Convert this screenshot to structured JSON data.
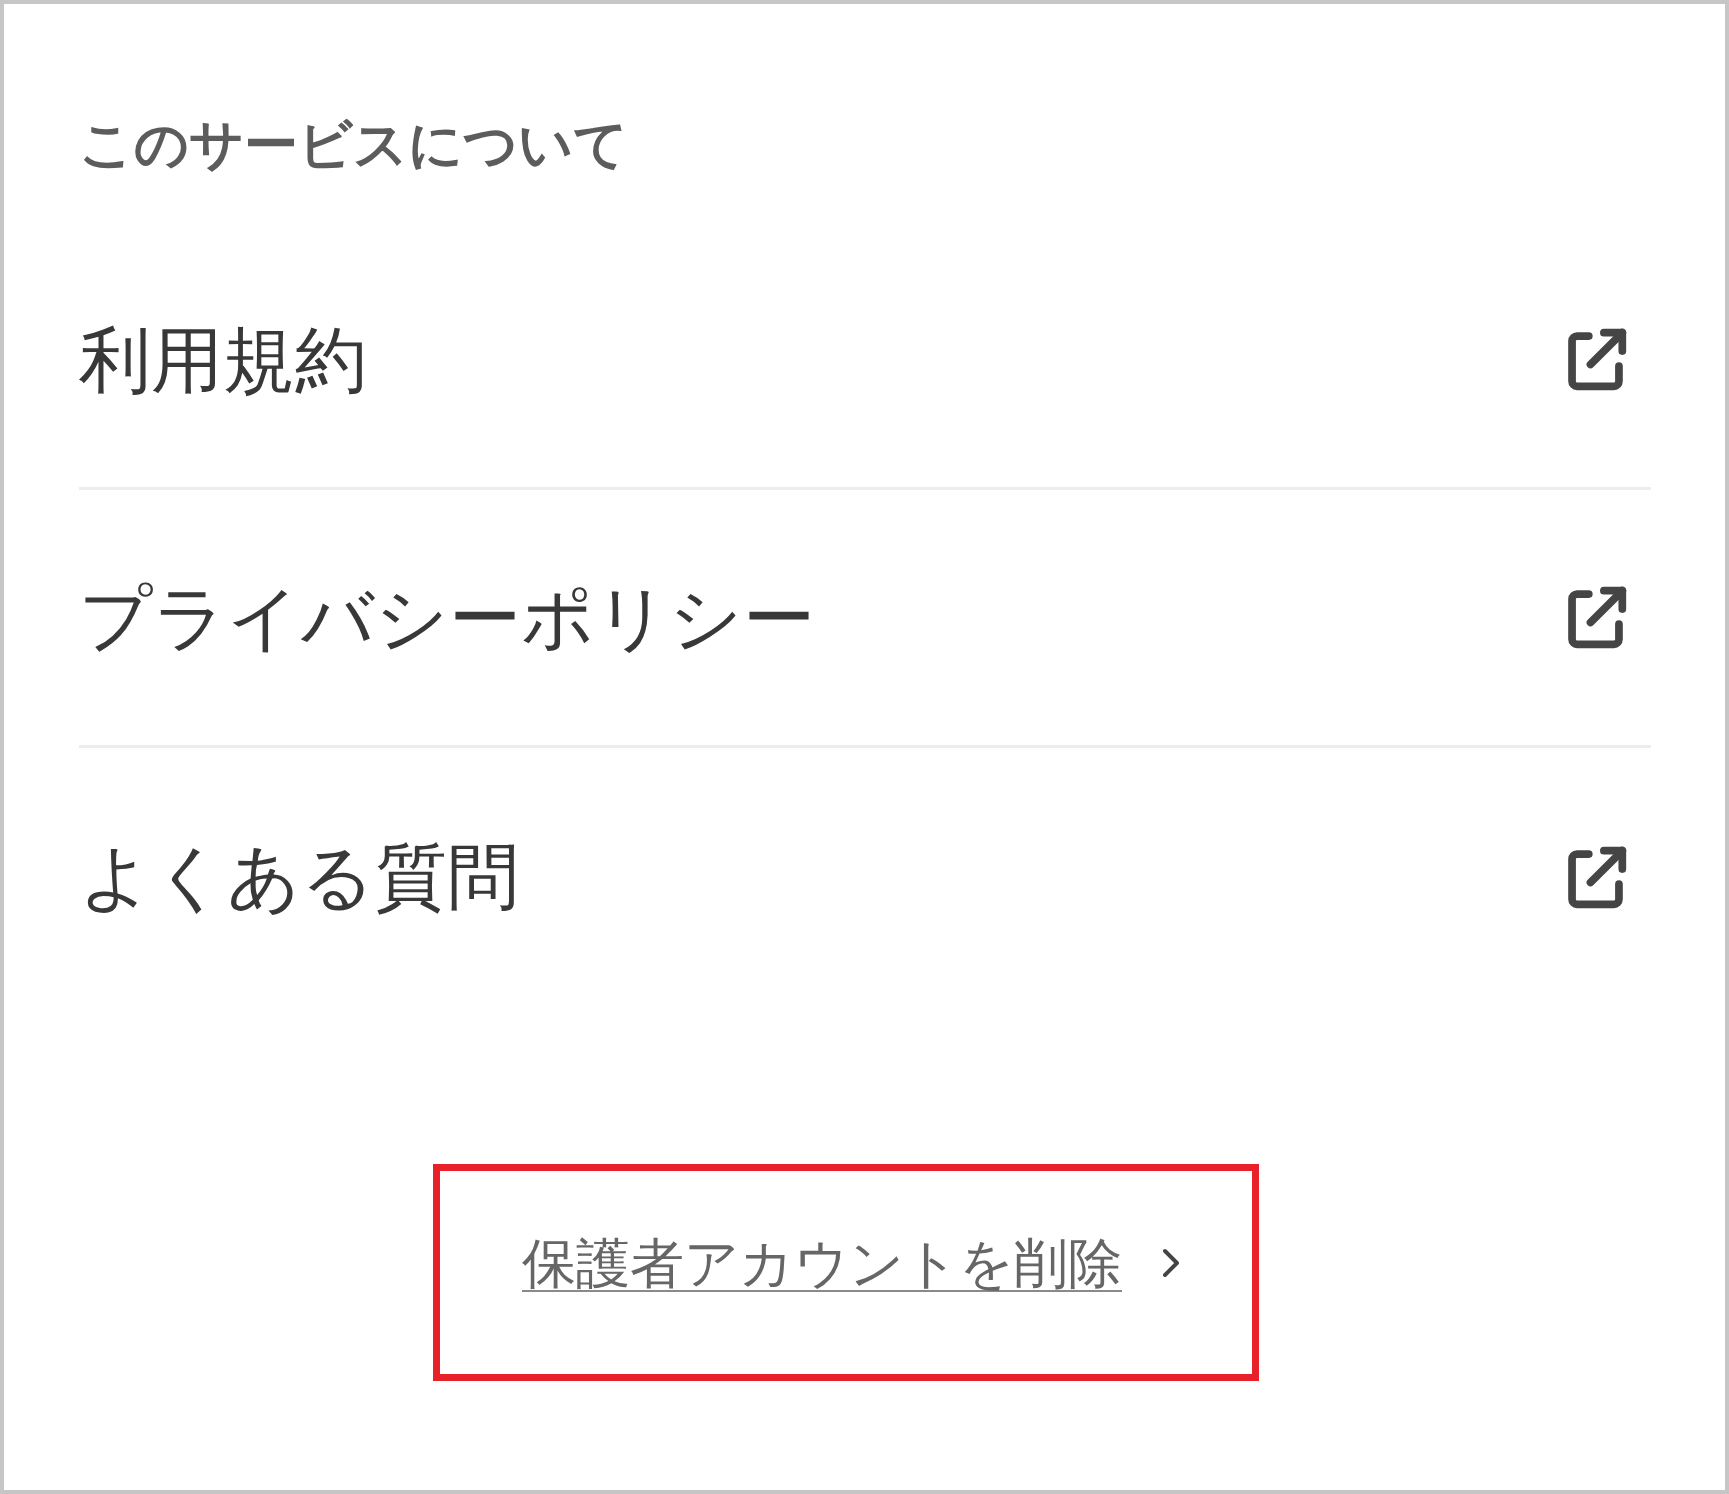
{
  "section": {
    "title": "このサービスについて"
  },
  "links": [
    {
      "label": "利用規約"
    },
    {
      "label": "プライバシーポリシー"
    },
    {
      "label": "よくある質問"
    }
  ],
  "delete_account": {
    "label": "保護者アカウントを削除",
    "highlighted": true
  }
}
